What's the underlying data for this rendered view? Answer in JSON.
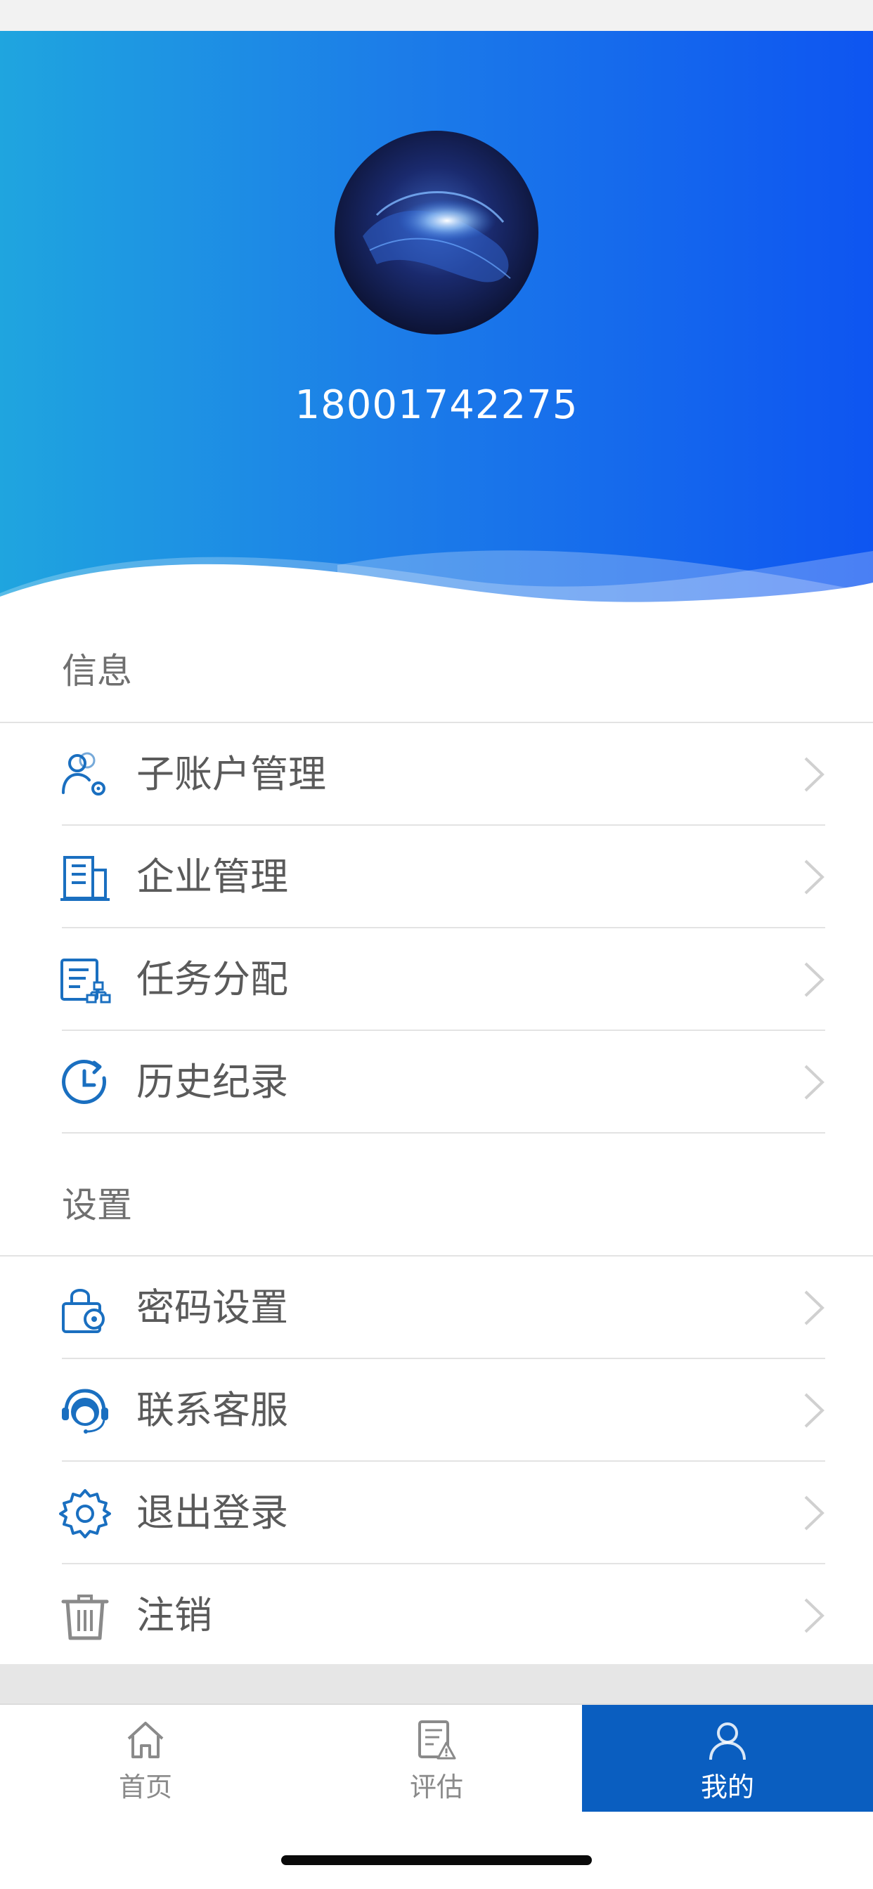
{
  "profile": {
    "phone": "18001742275"
  },
  "info_section": {
    "title": "信息",
    "items": [
      {
        "label": "子账户管理",
        "icon": "sub-account-icon"
      },
      {
        "label": "企业管理",
        "icon": "building-icon"
      },
      {
        "label": "任务分配",
        "icon": "task-assign-icon"
      },
      {
        "label": "历史纪录",
        "icon": "history-icon"
      }
    ]
  },
  "settings_section": {
    "title": "设置",
    "items": [
      {
        "label": "密码设置",
        "icon": "lock-gear-icon"
      },
      {
        "label": "联系客服",
        "icon": "headset-icon"
      },
      {
        "label": "退出登录",
        "icon": "gear-icon"
      },
      {
        "label": "注销",
        "icon": "trash-icon"
      }
    ]
  },
  "tab_bar": {
    "tabs": [
      {
        "label": "首页",
        "icon": "home-icon",
        "active": false
      },
      {
        "label": "评估",
        "icon": "assessment-icon",
        "active": false
      },
      {
        "label": "我的",
        "icon": "user-icon",
        "active": true
      }
    ]
  },
  "colors": {
    "accent": "#1a6fc0",
    "header_gradient_start": "#1fa5df",
    "header_gradient_end": "#0e55f1",
    "active_tab": "#0a5ec0"
  }
}
